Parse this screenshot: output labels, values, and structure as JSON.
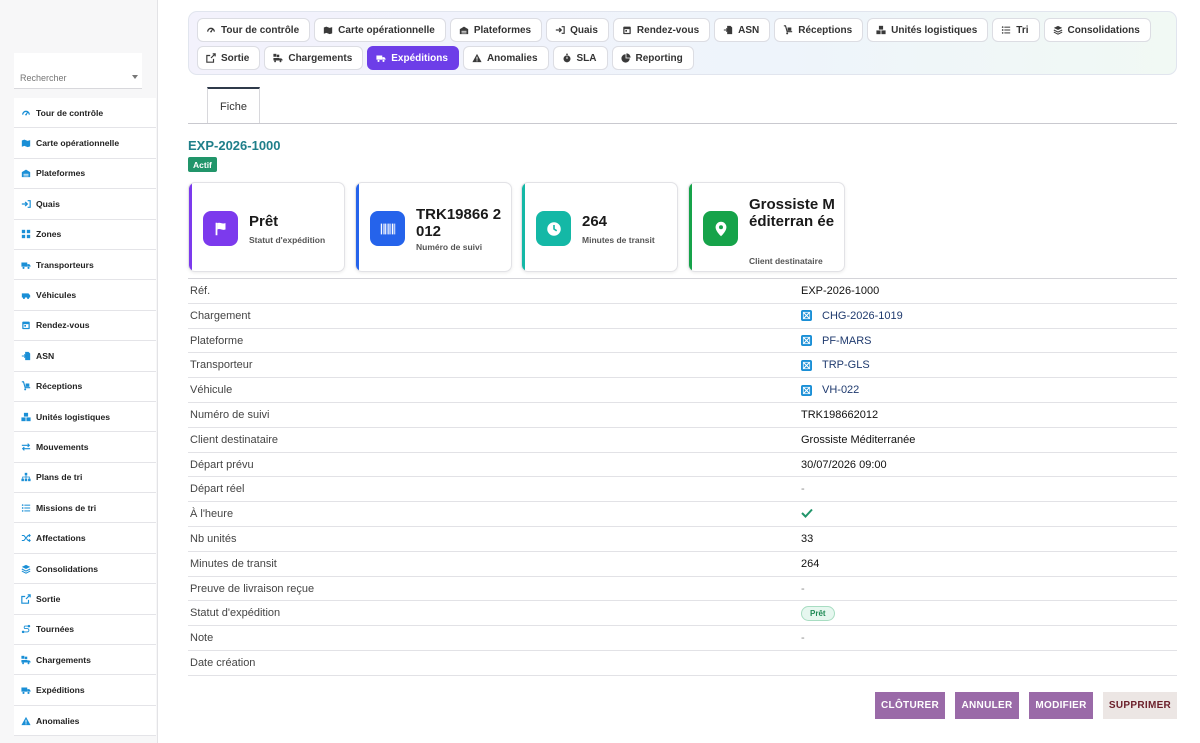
{
  "sidebar": {
    "search_placeholder": "Rechercher",
    "items": [
      {
        "label": "Tour de contrôle",
        "icon": "gauge-icon"
      },
      {
        "label": "Carte opérationnelle",
        "icon": "map-icon"
      },
      {
        "label": "Plateformes",
        "icon": "warehouse-icon"
      },
      {
        "label": "Quais",
        "icon": "sign-in-icon"
      },
      {
        "label": "Zones",
        "icon": "grid-icon"
      },
      {
        "label": "Transporteurs",
        "icon": "truck-icon"
      },
      {
        "label": "Véhicules",
        "icon": "van-icon"
      },
      {
        "label": "Rendez-vous",
        "icon": "calendar-icon"
      },
      {
        "label": "ASN",
        "icon": "file-import-icon"
      },
      {
        "label": "Réceptions",
        "icon": "dolly-icon"
      },
      {
        "label": "Unités logistiques",
        "icon": "boxes-icon"
      },
      {
        "label": "Mouvements",
        "icon": "arrows-icon"
      },
      {
        "label": "Plans de tri",
        "icon": "sitemap-icon"
      },
      {
        "label": "Missions de tri",
        "icon": "list-icon"
      },
      {
        "label": "Affectations",
        "icon": "shuffle-icon"
      },
      {
        "label": "Consolidations",
        "icon": "layers-icon"
      },
      {
        "label": "Sortie",
        "icon": "external-icon"
      },
      {
        "label": "Tournées",
        "icon": "route-icon"
      },
      {
        "label": "Chargements",
        "icon": "truck-loading-icon"
      },
      {
        "label": "Expéditions",
        "icon": "shipping-icon"
      },
      {
        "label": "Anomalies",
        "icon": "warning-icon"
      }
    ]
  },
  "topnav": {
    "row1": [
      {
        "label": "Tour de contrôle",
        "icon": "gauge-icon"
      },
      {
        "label": "Carte opérationnelle",
        "icon": "map-icon"
      },
      {
        "label": "Plateformes",
        "icon": "warehouse-icon"
      },
      {
        "label": "Quais",
        "icon": "sign-in-icon"
      },
      {
        "label": "Rendez-vous",
        "icon": "calendar-icon"
      },
      {
        "label": "ASN",
        "icon": "file-import-icon"
      },
      {
        "label": "Réceptions",
        "icon": "dolly-icon"
      },
      {
        "label": "Unités logistiques",
        "icon": "boxes-icon"
      },
      {
        "label": "Tri",
        "icon": "list-icon"
      },
      {
        "label": "Consolidations",
        "icon": "layers-icon"
      }
    ],
    "row2": [
      {
        "label": "Sortie",
        "icon": "external-icon"
      },
      {
        "label": "Chargements",
        "icon": "truck-loading-icon"
      },
      {
        "label": "Expéditions",
        "icon": "shipping-icon",
        "active": true
      },
      {
        "label": "Anomalies",
        "icon": "warning-icon"
      },
      {
        "label": "SLA",
        "icon": "stopwatch-icon"
      },
      {
        "label": "Reporting",
        "icon": "pie-chart-icon"
      }
    ]
  },
  "fiche_tab": "Fiche",
  "record": {
    "title": "EXP-2026-1000",
    "status": "Actif"
  },
  "cards": [
    {
      "value": "Prêt",
      "label": "Statut d'expédition",
      "icon": "flag-icon",
      "color": "#7c3aed"
    },
    {
      "value": "TRK19866 2012",
      "label": "Numéro de suivi",
      "icon": "barcode-icon",
      "color": "#2563eb"
    },
    {
      "value": "264",
      "label": "Minutes de transit",
      "icon": "clock-icon",
      "color": "#14b8a6"
    },
    {
      "value": "Grossiste Méditerran ée",
      "label": "Client destinataire",
      "icon": "map-pin-icon",
      "color": "#16a34a"
    }
  ],
  "fields": [
    {
      "label": "Réf.",
      "value": "EXP-2026-1000"
    },
    {
      "label": "Chargement",
      "value": "CHG-2026-1019",
      "link": true
    },
    {
      "label": "Plateforme",
      "value": "PF-MARS",
      "link": true
    },
    {
      "label": "Transporteur",
      "value": "TRP-GLS",
      "link": true
    },
    {
      "label": "Véhicule",
      "value": "VH-022",
      "link": true
    },
    {
      "label": "Numéro de suivi",
      "value": "TRK198662012"
    },
    {
      "label": "Client destinataire",
      "value": "Grossiste Méditerranée"
    },
    {
      "label": "Départ prévu",
      "value": "30/07/2026 09:00"
    },
    {
      "label": "Départ réel",
      "value": "-",
      "muted": true
    },
    {
      "label": "À l'heure",
      "value": "",
      "check": true
    },
    {
      "label": "Nb unités",
      "value": "33"
    },
    {
      "label": "Minutes de transit",
      "value": "264"
    },
    {
      "label": "Preuve de livraison reçue",
      "value": "-",
      "muted": true
    },
    {
      "label": "Statut d'expédition",
      "value": "Prêt",
      "pill": true
    },
    {
      "label": "Note",
      "value": "-",
      "muted": true
    },
    {
      "label": "Date création",
      "value": ""
    }
  ],
  "actions": {
    "close": "CLÔTURER",
    "cancel": "ANNULER",
    "edit": "MODIFIER",
    "delete": "SUPPRIMER"
  },
  "colors": {
    "accent": "#6d3ee8",
    "icon_blue": "#1a8fd6",
    "link": "#1f3a6e",
    "success": "#21956a"
  }
}
